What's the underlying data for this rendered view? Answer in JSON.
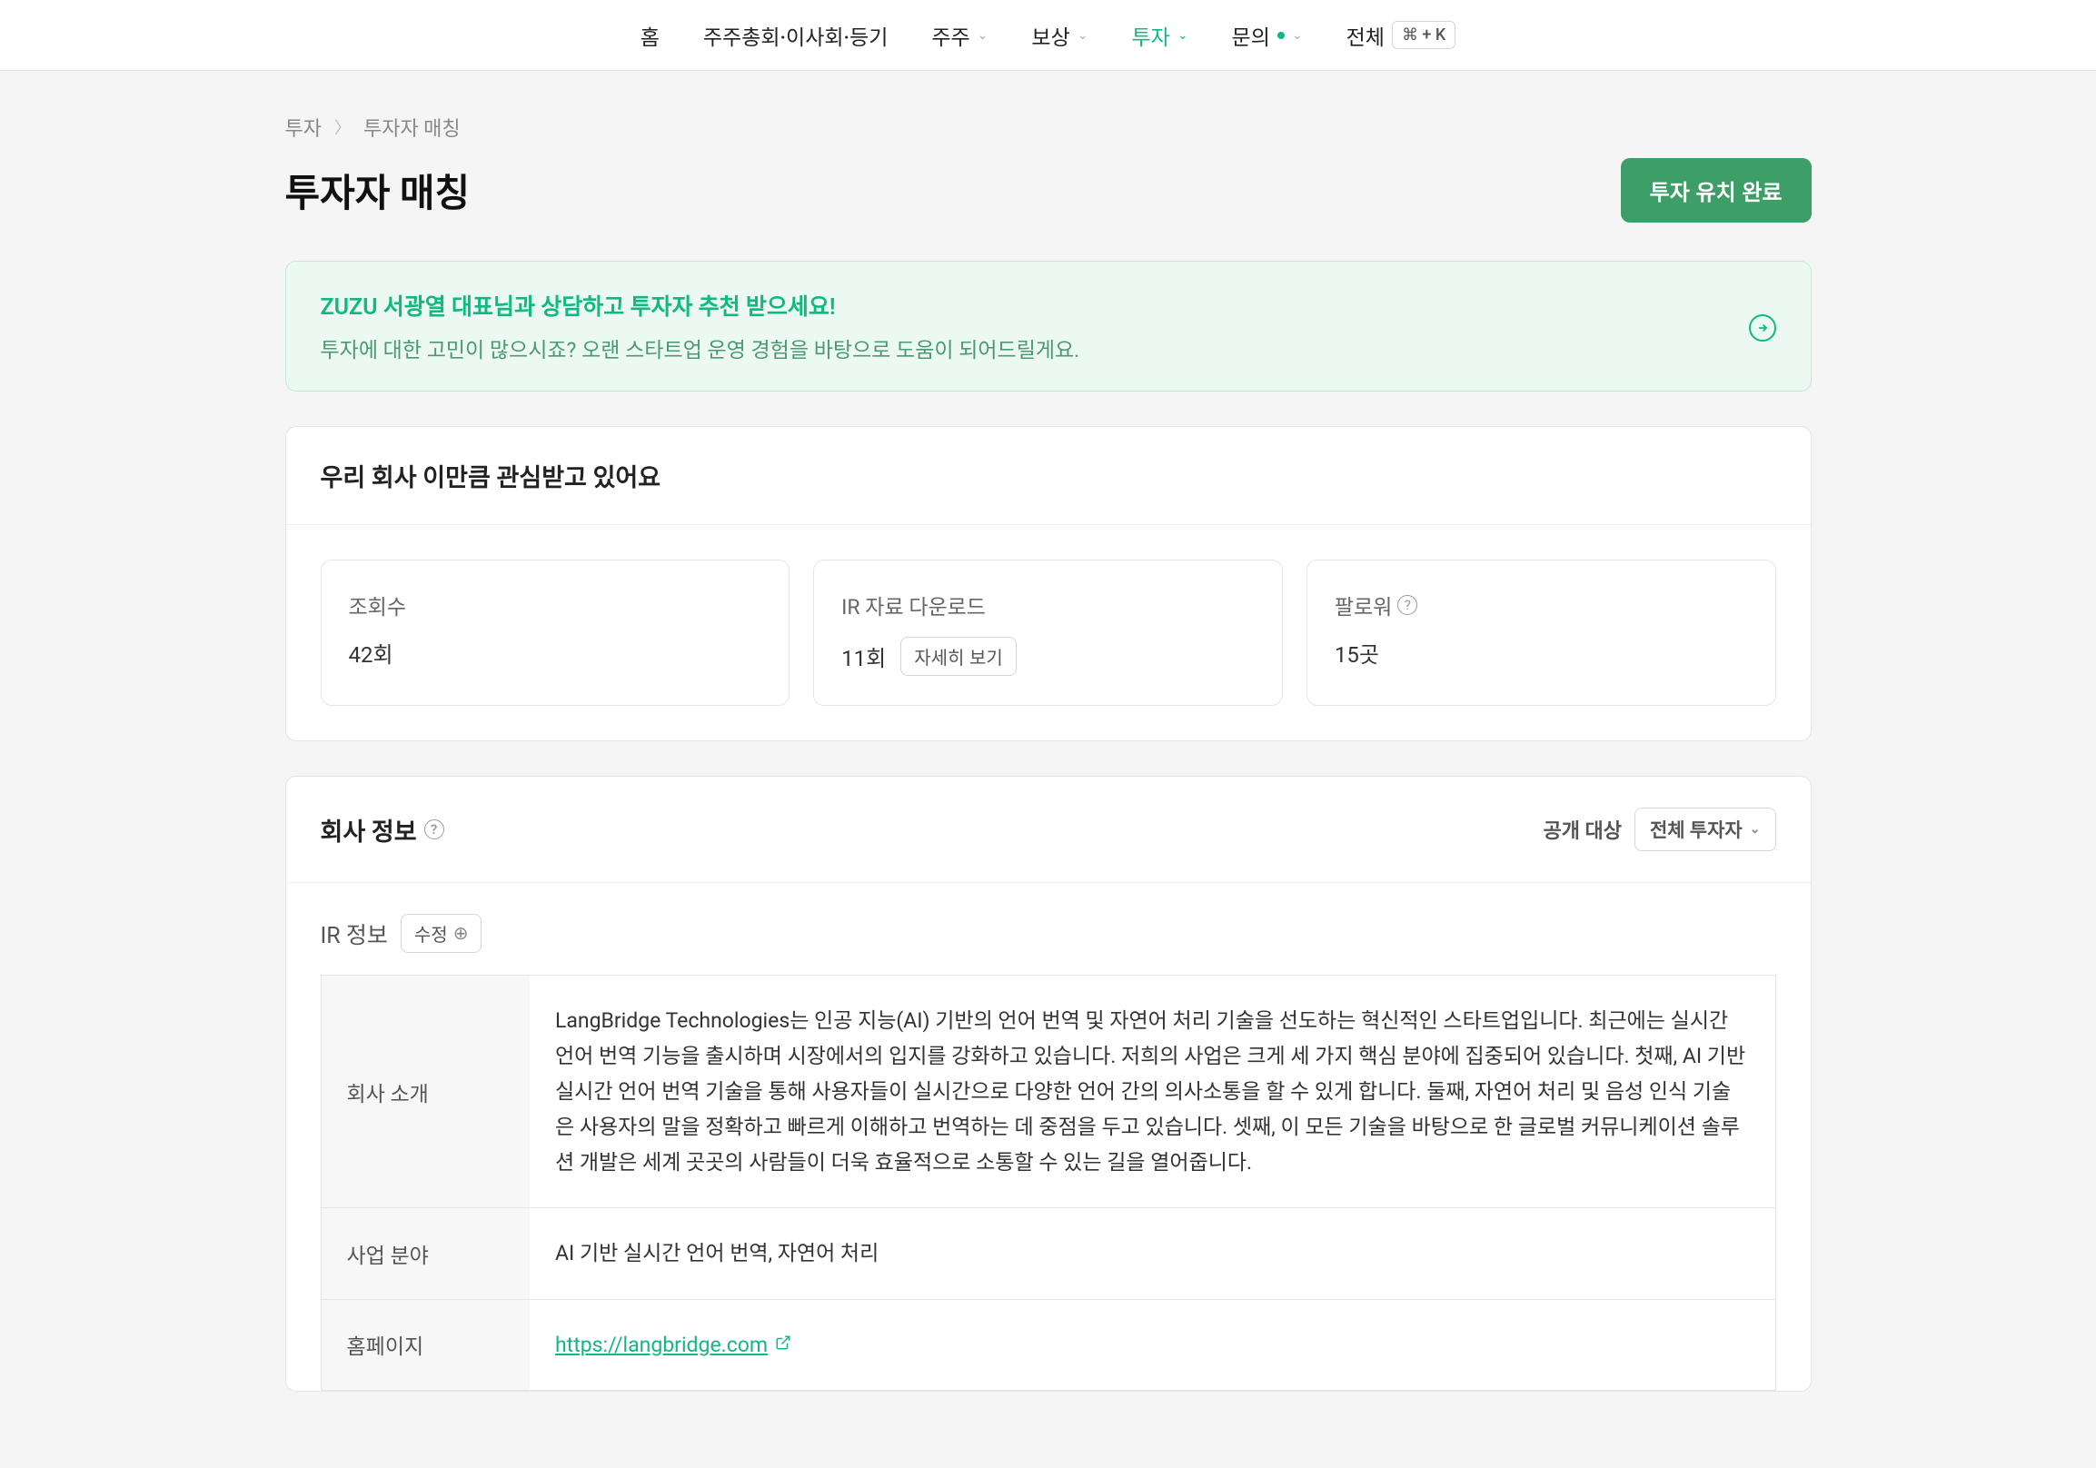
{
  "nav": {
    "items": [
      {
        "label": "홈"
      },
      {
        "label": "주주총회·이사회·등기"
      },
      {
        "label": "주주",
        "has_chevron": true
      },
      {
        "label": "보상",
        "has_chevron": true
      },
      {
        "label": "투자",
        "has_chevron": true,
        "active": true
      },
      {
        "label": "문의",
        "has_dot": true,
        "has_chevron": true
      },
      {
        "label": "전체"
      }
    ],
    "shortcut": "⌘ + K"
  },
  "breadcrumb": {
    "item1": "투자",
    "item2": "투자자 매칭"
  },
  "page_title": "투자자 매칭",
  "primary_button": "투자 유치 완료",
  "banner": {
    "title": "ZUZU 서광열 대표님과 상담하고 투자자 추천 받으세요!",
    "subtitle": "투자에 대한 고민이 많으시죠? 오랜 스타트업 운영 경험을 바탕으로 도움이 되어드릴게요."
  },
  "interest_card": {
    "title": "우리 회사 이만큼 관심받고 있어요",
    "stats": [
      {
        "label": "조회수",
        "value": "42회"
      },
      {
        "label": "IR 자료 다운로드",
        "value": "11회",
        "detail_btn": "자세히 보기"
      },
      {
        "label": "팔로워",
        "value": "15곳",
        "has_help": true
      }
    ]
  },
  "company_card": {
    "title": "회사 정보",
    "visibility_label": "공개 대상",
    "visibility_value": "전체 투자자",
    "ir_section_title": "IR 정보",
    "edit_btn": "수정",
    "rows": [
      {
        "label": "회사 소개",
        "value": "LangBridge Technologies는 인공 지능(AI) 기반의 언어 번역 및 자연어 처리 기술을 선도하는 혁신적인 스타트업입니다. 최근에는 실시간 언어 번역 기능을 출시하며 시장에서의 입지를 강화하고 있습니다. 저희의 사업은 크게 세 가지 핵심 분야에 집중되어 있습니다. 첫째, AI 기반 실시간 언어 번역 기술을 통해 사용자들이 실시간으로 다양한 언어 간의 의사소통을 할 수 있게 합니다. 둘째, 자연어 처리 및 음성 인식 기술은 사용자의 말을 정확하고 빠르게 이해하고 번역하는 데 중점을 두고 있습니다. 셋째, 이 모든 기술을 바탕으로 한 글로벌 커뮤니케이션 솔루션 개발은 세계 곳곳의 사람들이 더욱 효율적으로 소통할 수 있는 길을 열어줍니다."
      },
      {
        "label": "사업 분야",
        "value": "AI 기반 실시간 언어 번역, 자연어 처리"
      },
      {
        "label": "홈페이지",
        "link": "https://langbridge.com"
      }
    ]
  }
}
